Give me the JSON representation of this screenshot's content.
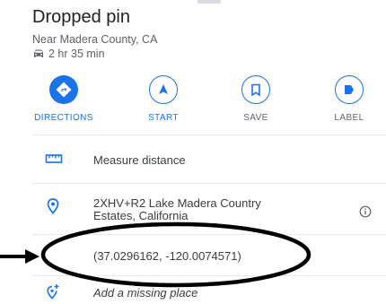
{
  "place": {
    "title": "Dropped pin",
    "subtitle": "Near Madera County, CA",
    "drive_time": "2 hr 35 min"
  },
  "actions": [
    {
      "label": "DIRECTIONS",
      "icon": "directions-icon"
    },
    {
      "label": "START",
      "icon": "navigation-icon"
    },
    {
      "label": "SAVE",
      "icon": "bookmark-icon"
    },
    {
      "label": "LABEL",
      "icon": "flag-icon"
    }
  ],
  "rows": {
    "measure": "Measure distance",
    "plus_code_line1": "2XHV+R2 Lake Madera Country",
    "plus_code_line2": "Estates, California",
    "coordinates": "(37.0296162, -120.0074571)",
    "add_place": "Add a missing place"
  },
  "colors": {
    "accent": "#1a73e8",
    "text": "#202124",
    "secondary": "#5f6368",
    "annotation": "#000000"
  }
}
